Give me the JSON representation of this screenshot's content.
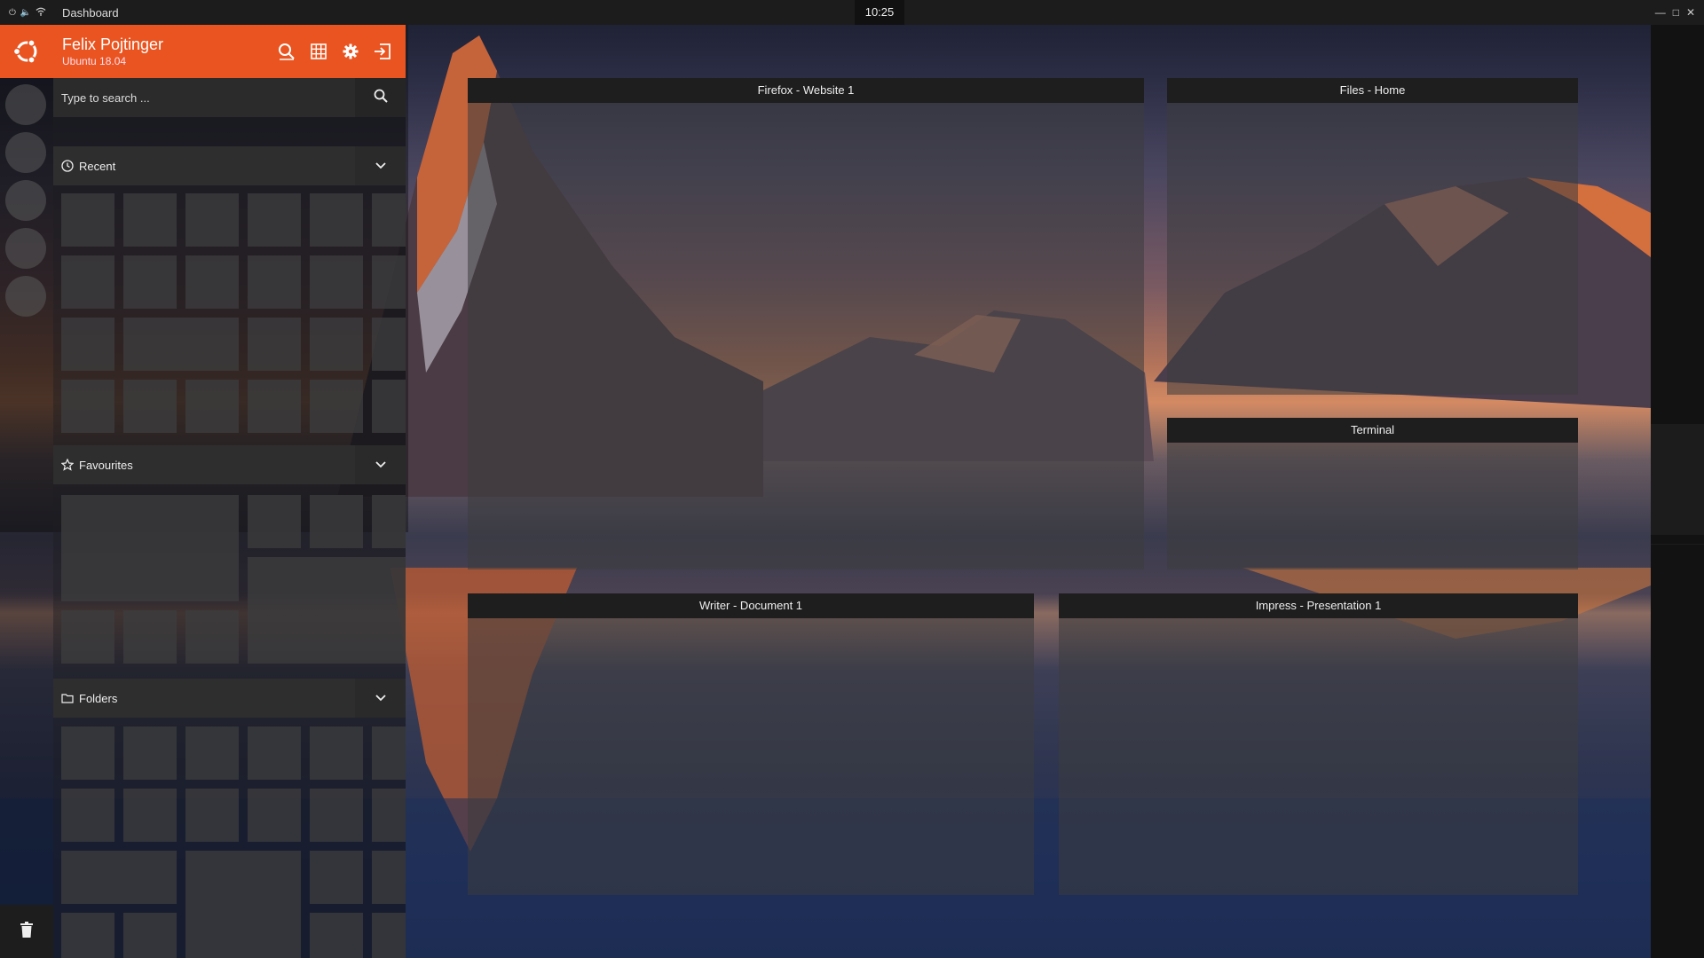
{
  "topbar": {
    "app_title": "Dashboard",
    "clock": "10:25",
    "tray_icons": [
      "power-icon",
      "volume-icon",
      "wifi-icon"
    ],
    "window_controls": [
      "minimize-icon",
      "maximize-icon",
      "close-icon"
    ]
  },
  "dash_header": {
    "user_name": "Felix Pojtinger",
    "os_version": "Ubuntu 18.04",
    "logo": "ubuntu-logo-icon",
    "actions": [
      "search-icon",
      "grid-icon",
      "gear-icon",
      "logout-icon"
    ]
  },
  "search": {
    "placeholder": "Type to search ...",
    "value": ""
  },
  "sections": {
    "recent": {
      "label": "Recent",
      "icon": "clock-icon"
    },
    "favourites": {
      "label": "Favourites",
      "icon": "star-icon"
    },
    "folders": {
      "label": "Folders",
      "icon": "folder-icon"
    }
  },
  "windows": [
    {
      "title": "Firefox - Website 1"
    },
    {
      "title": "Files - Home"
    },
    {
      "title": "Terminal"
    },
    {
      "title": "Writer - Document 1"
    },
    {
      "title": "Impress - Presentation 1"
    }
  ],
  "dock": {
    "trash": "trash-icon"
  },
  "colors": {
    "accent": "#e95420",
    "topbar": "#1c1c1c",
    "panel": "#2e2e2e"
  }
}
